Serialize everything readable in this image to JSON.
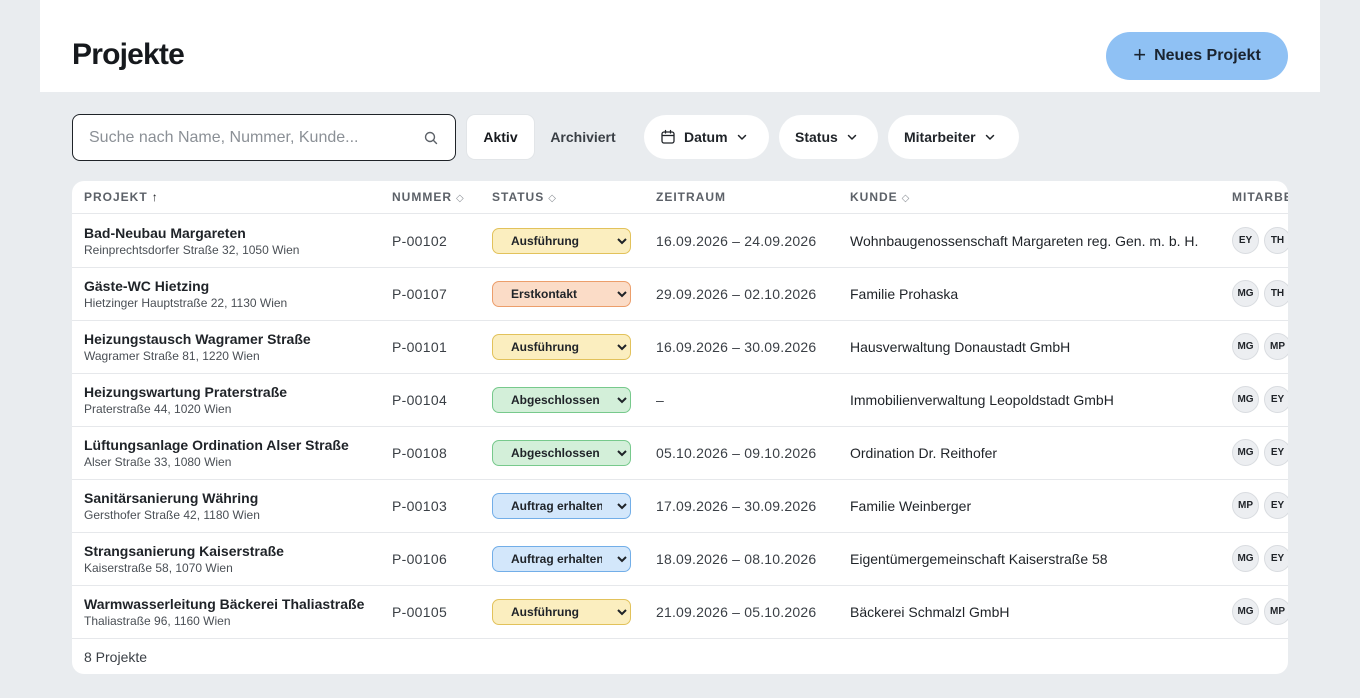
{
  "header": {
    "title": "Projekte",
    "new_button": "Neues Projekt"
  },
  "search": {
    "placeholder": "Suche nach Name, Nummer, Kunde..."
  },
  "tabs": {
    "active": "Aktiv",
    "archived": "Archiviert"
  },
  "filters": {
    "date": "Datum",
    "status": "Status",
    "staff": "Mitarbeiter"
  },
  "table": {
    "columns": {
      "project": "PROJEKT",
      "number": "NUMMER",
      "status": "STATUS",
      "period": "ZEITRAUM",
      "customer": "KUNDE",
      "staff": "MITARBE"
    },
    "rows": [
      {
        "name": "Bad-Neubau Margareten",
        "address": "Reinprechtsdorfer Straße 32, 1050 Wien",
        "number": "P-00102",
        "status": "Ausführung",
        "period": "16.09.2026 – 24.09.2026",
        "customer": "Wohnbaugenossenschaft Margareten reg. Gen. m. b. H.",
        "staff": [
          "EY",
          "TH"
        ]
      },
      {
        "name": "Gäste-WC Hietzing",
        "address": "Hietzinger Hauptstraße 22, 1130 Wien",
        "number": "P-00107",
        "status": "Erstkontakt",
        "period": "29.09.2026 – 02.10.2026",
        "customer": "Familie Prohaska",
        "staff": [
          "MG",
          "TH"
        ]
      },
      {
        "name": "Heizungstausch Wagramer Straße",
        "address": "Wagramer Straße 81, 1220 Wien",
        "number": "P-00101",
        "status": "Ausführung",
        "period": "16.09.2026 – 30.09.2026",
        "customer": "Hausverwaltung Donaustadt GmbH",
        "staff": [
          "MG",
          "MP"
        ]
      },
      {
        "name": "Heizungswartung Praterstraße",
        "address": "Praterstraße 44, 1020 Wien",
        "number": "P-00104",
        "status": "Abgeschlossen",
        "period": "–",
        "customer": "Immobilienverwaltung Leopoldstadt GmbH",
        "staff": [
          "MG",
          "EY"
        ]
      },
      {
        "name": "Lüftungsanlage Ordination Alser Straße",
        "address": "Alser Straße 33, 1080 Wien",
        "number": "P-00108",
        "status": "Abgeschlossen",
        "period": "05.10.2026 – 09.10.2026",
        "customer": "Ordination Dr. Reithofer",
        "staff": [
          "MG",
          "EY"
        ]
      },
      {
        "name": "Sanitärsanierung Währing",
        "address": "Gersthofer Straße 42, 1180 Wien",
        "number": "P-00103",
        "status": "Auftrag erhalten",
        "period": "17.09.2026 – 30.09.2026",
        "customer": "Familie Weinberger",
        "staff": [
          "MP",
          "EY"
        ]
      },
      {
        "name": "Strangsanierung Kaiserstraße",
        "address": "Kaiserstraße 58, 1070 Wien",
        "number": "P-00106",
        "status": "Auftrag erhalten",
        "period": "18.09.2026 – 08.10.2026",
        "customer": "Eigentümergemeinschaft Kaiserstraße 58",
        "staff": [
          "MG",
          "EY"
        ]
      },
      {
        "name": "Warmwasserleitung Bäckerei Thaliastraße",
        "address": "Thaliastraße 96, 1160 Wien",
        "number": "P-00105",
        "status": "Ausführung",
        "period": "21.09.2026 – 05.10.2026",
        "customer": "Bäckerei Schmalzl GmbH",
        "staff": [
          "MG",
          "MP"
        ]
      }
    ],
    "footer": "8 Projekte"
  },
  "colors": {
    "accent": "#8fc1f4",
    "status_ausfuehrung": "#fbeebf",
    "status_erstkontakt": "#fbdcc7",
    "status_abgeschlossen": "#d3efd9",
    "status_auftrag_erhalten": "#d3e7fb"
  }
}
